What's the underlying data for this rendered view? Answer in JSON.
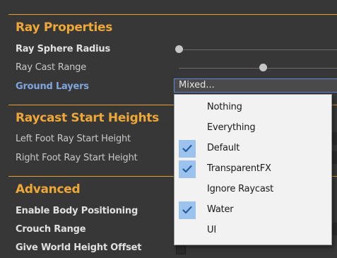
{
  "sections": {
    "ray_properties": "Ray Properties",
    "raycast_start_heights": "Raycast Start Heights",
    "advanced": "Advanced"
  },
  "fields": {
    "ray_sphere_radius": "Ray Sphere Radius",
    "ray_cast_range": "Ray Cast Range",
    "ground_layers": "Ground Layers",
    "left_foot_ray_start_height": "Left Foot Ray Start Height",
    "right_foot_ray_start_height": "Right Foot Ray Start Height",
    "enable_body_positioning": "Enable Body Positioning",
    "crouch_range": "Crouch Range",
    "give_world_height_offset": "Give World Height Offset"
  },
  "ground_layers_value": "Mixed...",
  "layer_options": [
    {
      "label": "Nothing",
      "checked": false
    },
    {
      "label": "Everything",
      "checked": false
    },
    {
      "label": "Default",
      "checked": true
    },
    {
      "label": "TransparentFX",
      "checked": true
    },
    {
      "label": "Ignore Raycast",
      "checked": false
    },
    {
      "label": "Water",
      "checked": true
    },
    {
      "label": "UI",
      "checked": false
    }
  ],
  "colors": {
    "section_header": "#f0a835",
    "selected_label": "#7fa6dc",
    "check_highlight": "#9cc3ee",
    "checkmark": "#2a5aa0"
  }
}
